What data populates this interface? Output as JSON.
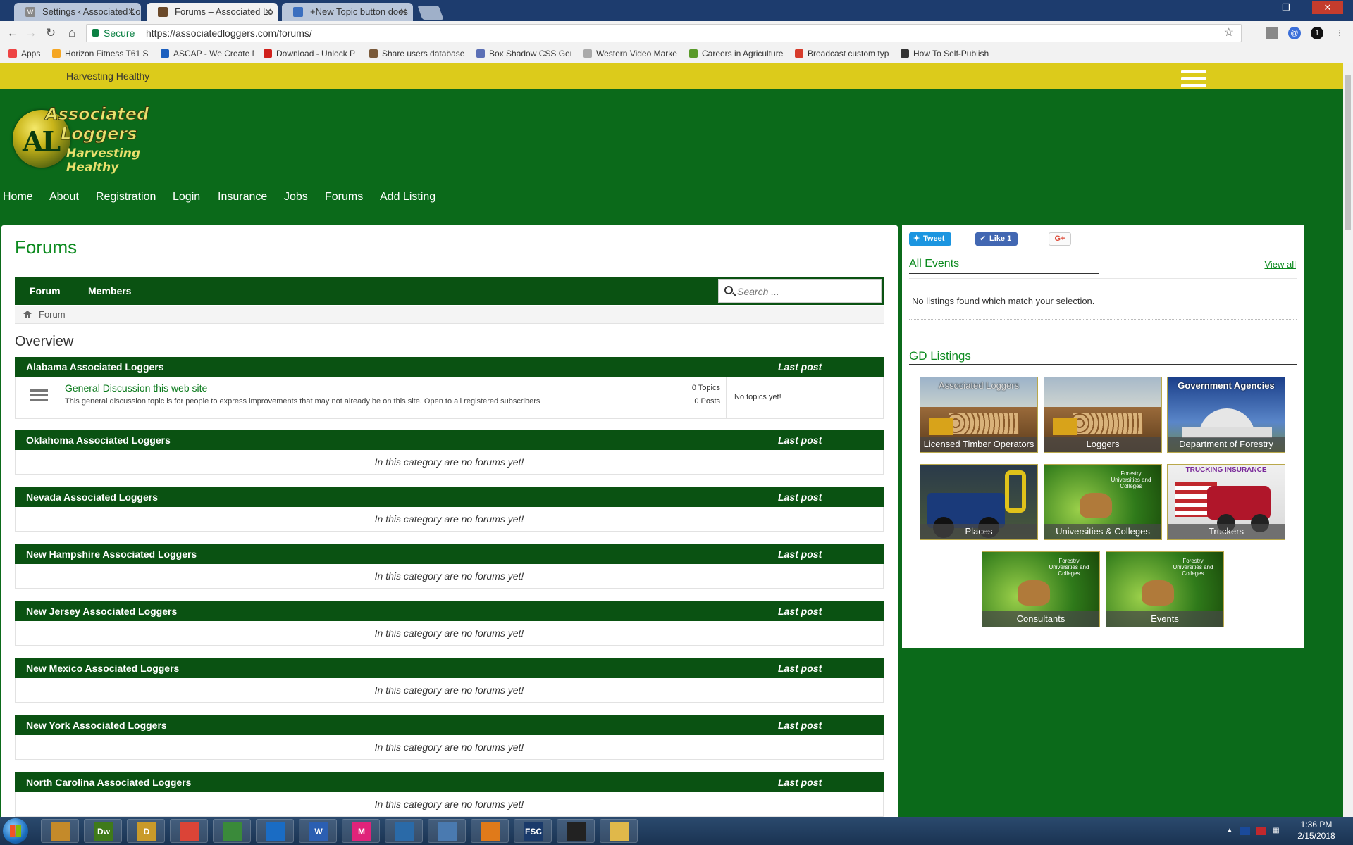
{
  "browser": {
    "tabs": [
      {
        "label": "Settings ‹ Associated Lo",
        "close": "✕"
      },
      {
        "label": "Forums – Associated Lo",
        "close": "✕",
        "active": true
      },
      {
        "label": "+New Topic button does",
        "close": "✕"
      }
    ],
    "secure_label": "Secure",
    "url": "https://associatedloggers.com/forums/",
    "bookmarks": [
      {
        "label": "Apps",
        "color": "#e44"
      },
      {
        "label": "Horizon Fitness T61 S",
        "color": "#f5a623"
      },
      {
        "label": "ASCAP - We Create M",
        "color": "#1b5fbf"
      },
      {
        "label": "Download - Unlock P",
        "color": "#d0201b"
      },
      {
        "label": "Share users database",
        "color": "#7a5a3a"
      },
      {
        "label": "Box Shadow CSS Gen",
        "color": "#5b6fb5"
      },
      {
        "label": "Western Video Marke",
        "color": "#aaaaaa"
      },
      {
        "label": "Careers in Agriculture",
        "color": "#5a9a2a"
      },
      {
        "label": "Broadcast custom typ",
        "color": "#d63b2b"
      },
      {
        "label": "How To Self-Publish",
        "color": "#333333"
      }
    ]
  },
  "site": {
    "tagline": "Harvesting Healthy",
    "logo": {
      "initials": "AL",
      "line1": "Associated",
      "line2": "Loggers",
      "line3": "Harvesting Healthy"
    },
    "nav": [
      "Home",
      "About",
      "Registration",
      "Login",
      "Insurance",
      "Jobs",
      "Forums",
      "Add Listing"
    ]
  },
  "forums": {
    "page_title": "Forums",
    "tabs": [
      "Forum",
      "Members"
    ],
    "search_placeholder": "Search ...",
    "breadcrumb": "Forum",
    "overview": "Overview",
    "last_post_label": "Last post",
    "empty_text": "In this category are no forums yet!",
    "categories": [
      {
        "name": "Alabama Associated Loggers",
        "forum": {
          "title": "General Discussion this web site",
          "description": "This general discussion topic is for people to express improvements that may not already be on this site. Open to all registered subscribers",
          "topics": "0 Topics",
          "posts": "0 Posts",
          "last": "No topics yet!"
        }
      },
      {
        "name": "Oklahoma Associated Loggers"
      },
      {
        "name": "Nevada Associated Loggers"
      },
      {
        "name": "New Hampshire Associated Loggers"
      },
      {
        "name": "New Jersey Associated Loggers"
      },
      {
        "name": "New Mexico Associated Loggers"
      },
      {
        "name": "New York Associated Loggers"
      },
      {
        "name": "North Carolina Associated Loggers"
      }
    ]
  },
  "sidebar": {
    "tweet": "Tweet",
    "like": "Like 1",
    "gplus": "G+",
    "events_title": "All Events",
    "view_all": "View all",
    "events_empty": "No listings found which match your selection.",
    "gd_title": "GD Listings",
    "tiles": [
      {
        "caption": "Licensed Timber Operators",
        "top": "Associated Loggers"
      },
      {
        "caption": "Loggers"
      },
      {
        "caption": "Department of Forestry",
        "top": "Government Agencies"
      },
      {
        "caption": "Places"
      },
      {
        "caption": "Universities & Colleges",
        "small": "Forestry Universities and Colleges"
      },
      {
        "caption": "Truckers",
        "top": "TRUCKING INSURANCE"
      },
      {
        "caption": "Consultants",
        "small": "Forestry Universities and Colleges"
      },
      {
        "caption": "Events",
        "small": "Forestry Universities and Colleges"
      }
    ]
  },
  "taskbar": {
    "apps": [
      {
        "label": "",
        "icon": "media-player-icon",
        "color": "#c48a2a"
      },
      {
        "label": "Dw",
        "icon": "dreamweaver-icon",
        "color": "#3f7a1a"
      },
      {
        "label": "D",
        "icon": "d-app-icon",
        "color": "#c99a2a"
      },
      {
        "label": "",
        "icon": "chrome-icon",
        "color": "#db4437"
      },
      {
        "label": "",
        "icon": "spreadsheet-icon",
        "color": "#3a8a3a"
      },
      {
        "label": "",
        "icon": "outlook-icon",
        "color": "#1a6cc4"
      },
      {
        "label": "W",
        "icon": "word-icon",
        "color": "#2b5fb2"
      },
      {
        "label": "M",
        "icon": "m-app-icon",
        "color": "#e0237a"
      },
      {
        "label": "",
        "icon": "pen-app-icon",
        "color": "#2a6aa8"
      },
      {
        "label": "",
        "icon": "chart-app-icon",
        "color": "#4a7ab0"
      },
      {
        "label": "",
        "icon": "flower-app-icon",
        "color": "#e07a1a"
      },
      {
        "label": "FSC",
        "icon": "fsc-rater-icon",
        "color": "#1a3a6a"
      },
      {
        "label": "",
        "icon": "terminal-icon",
        "color": "#222222"
      },
      {
        "label": "",
        "icon": "folder-icon",
        "color": "#e0b84a"
      }
    ],
    "time": "1:36 PM",
    "date": "2/15/2018"
  },
  "colors": {
    "brand_green": "#0b6a1a",
    "dark_green": "#0a5212",
    "yellow": "#dccb1b",
    "link_green": "#0b8a1e"
  }
}
